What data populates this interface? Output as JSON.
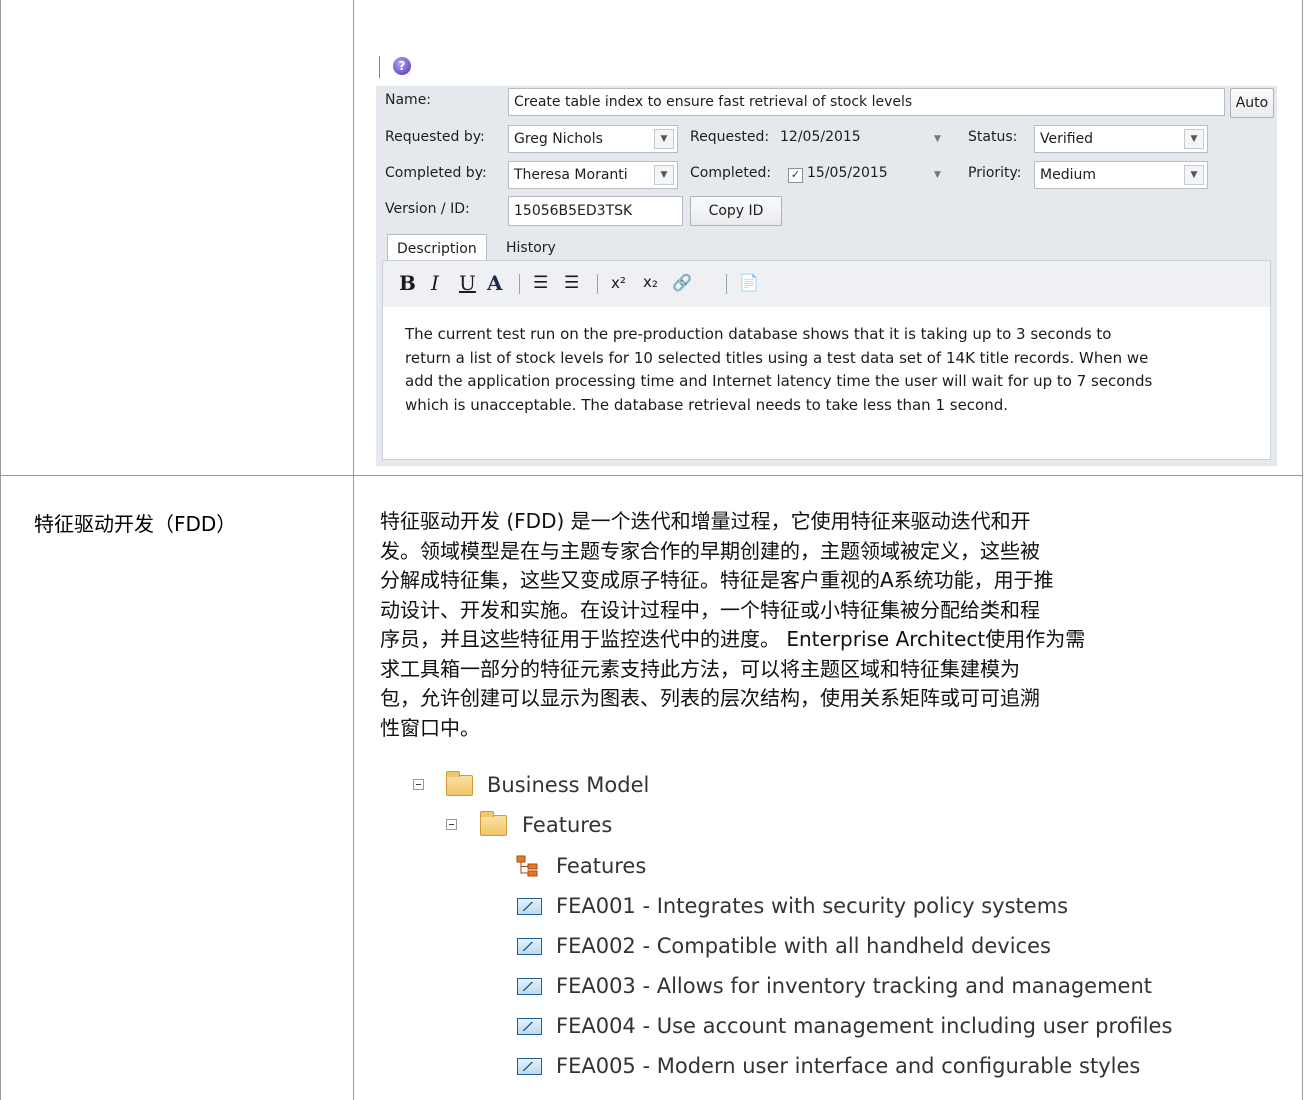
{
  "dialog": {
    "name_label": "Name:",
    "name_value": "Create table index to ensure fast retrieval of stock levels",
    "auto_button": "Auto",
    "requested_by_label": "Requested by:",
    "requested_by_value": "Greg Nichols",
    "requested_label": "Requested:",
    "requested_value": "12/05/2015",
    "status_label": "Status:",
    "status_value": "Verified",
    "completed_by_label": "Completed by:",
    "completed_by_value": "Theresa Moranti",
    "completed_label": "Completed:",
    "completed_checked": true,
    "completed_value": "15/05/2015",
    "priority_label": "Priority:",
    "priority_value": "Medium",
    "version_label": "Version / ID:",
    "version_value": "15056B5ED3TSK",
    "copy_id_button": "Copy ID",
    "tabs": [
      {
        "label": "Description",
        "active": true
      },
      {
        "label": "History",
        "active": false
      }
    ],
    "toolbar": {
      "bold": "B",
      "italic": "I",
      "underline": "U",
      "font_color": "A",
      "bullet_list": "☰",
      "numbered_list": "☰",
      "superscript": "x²",
      "subscript": "x₂",
      "hyperlink": "🔗",
      "document": "📄"
    },
    "description_lines": [
      "The current test run on the pre-production database shows that it is taking up to 3 seconds to",
      "return a list of stock levels for 10 selected titles using a test data set of 14K title records. When we",
      "add the application processing time and Internet latency time the user will wait for up to 7 seconds",
      "which is unacceptable. The database retrieval needs to take less than 1 second."
    ]
  },
  "fdd": {
    "name": "特征驱动开发（FDD）",
    "paragraph_lines": [
      "特征驱动开发 (FDD) 是一个迭代和增量过程，它使用特征来驱动迭代和开",
      "发。领域模型是在与主题专家合作的早期创建的，主题领域被定义，这些被",
      "分解成特征集，这些又变成原子特征。特征是客户重视的A系统功能，用于推",
      "动设计、开发和实施。在设计过程中，一个特征或小特征集被分配给类和程",
      "序员，并且这些特征用于监控迭代中的进度。 Enterprise Architect使用作为需",
      "求工具箱一部分的特征元素支持此方法，可以将主题区域和特征集建模为",
      "包，允许创建可以显示为图表、列表的层次结构，使用关系矩阵或可可追溯",
      "性窗口中。"
    ],
    "tree": {
      "root": "Business Model",
      "folder": "Features",
      "diagram": "Features",
      "items": [
        "FEA001 - Integrates with security policy systems",
        "FEA002 - Compatible with all handheld devices",
        "FEA003 - Allows for inventory tracking and management",
        "FEA004 - Use account management including user profiles",
        "FEA005 - Modern user interface and configurable styles"
      ]
    }
  }
}
